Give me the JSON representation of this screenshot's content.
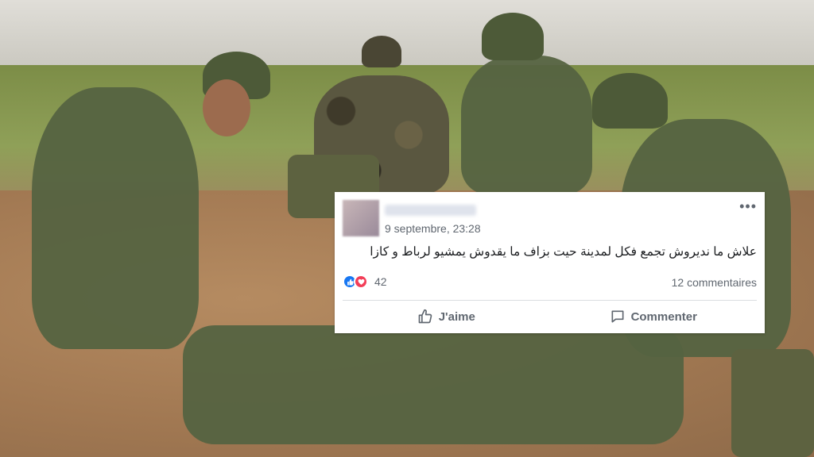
{
  "post": {
    "timestamp": "9 septembre, 23:28",
    "text": "علاش ما نديروش تجمع فكل لمدينة حيت بزاف ما يقدوش يمشيو لرباط و كازا",
    "reaction_count": "42",
    "comments_count": "12 commentaires",
    "like_label": "J'aime",
    "comment_label": "Commenter",
    "menu_icon": "more-icon"
  },
  "colors": {
    "like_blue": "#1877f2",
    "love_red": "#f33e58",
    "secondary_text": "#606770"
  }
}
